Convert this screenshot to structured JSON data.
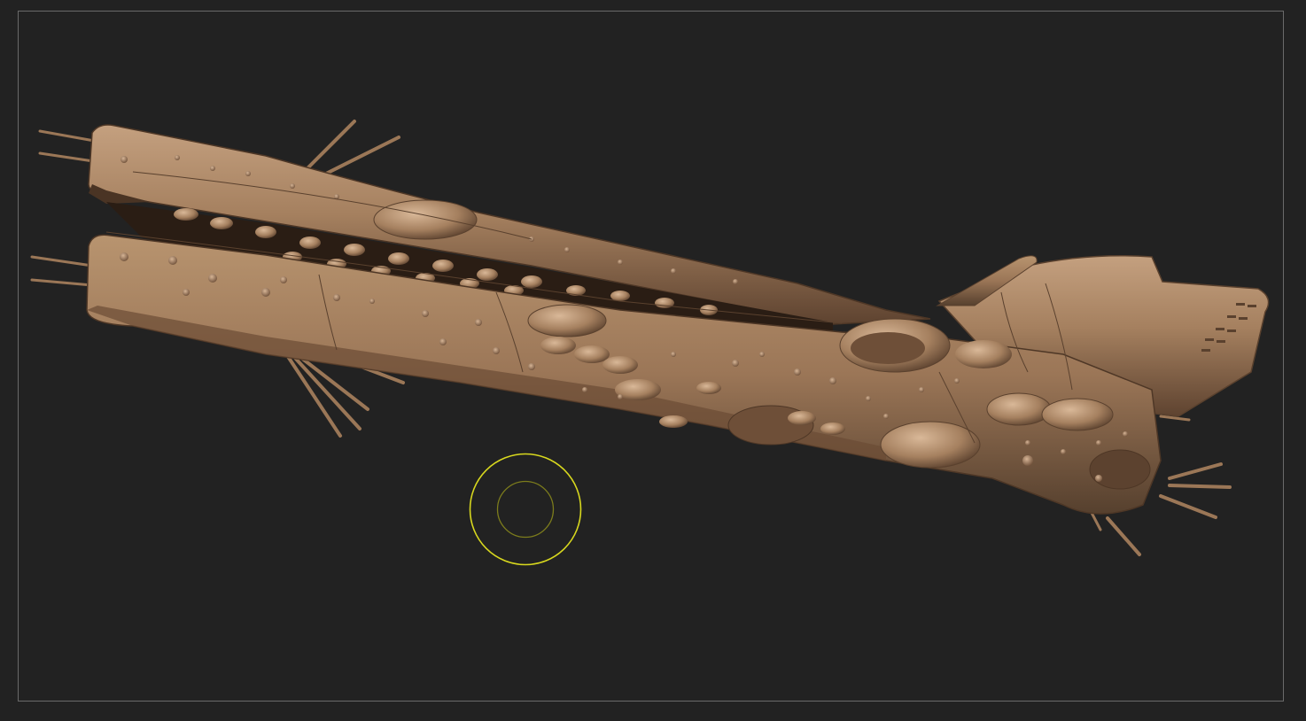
{
  "app": {
    "name": "",
    "canvas_background": "#222222",
    "frame_border_color": "#6a6a6a"
  },
  "model": {
    "material_color": "#a5805f",
    "shadow_color": "#4e3726",
    "highlight_color": "#c9a585"
  },
  "brush": {
    "outer_ring_color": "#d8d81e",
    "inner_ring_color": "#7c7c1c"
  }
}
